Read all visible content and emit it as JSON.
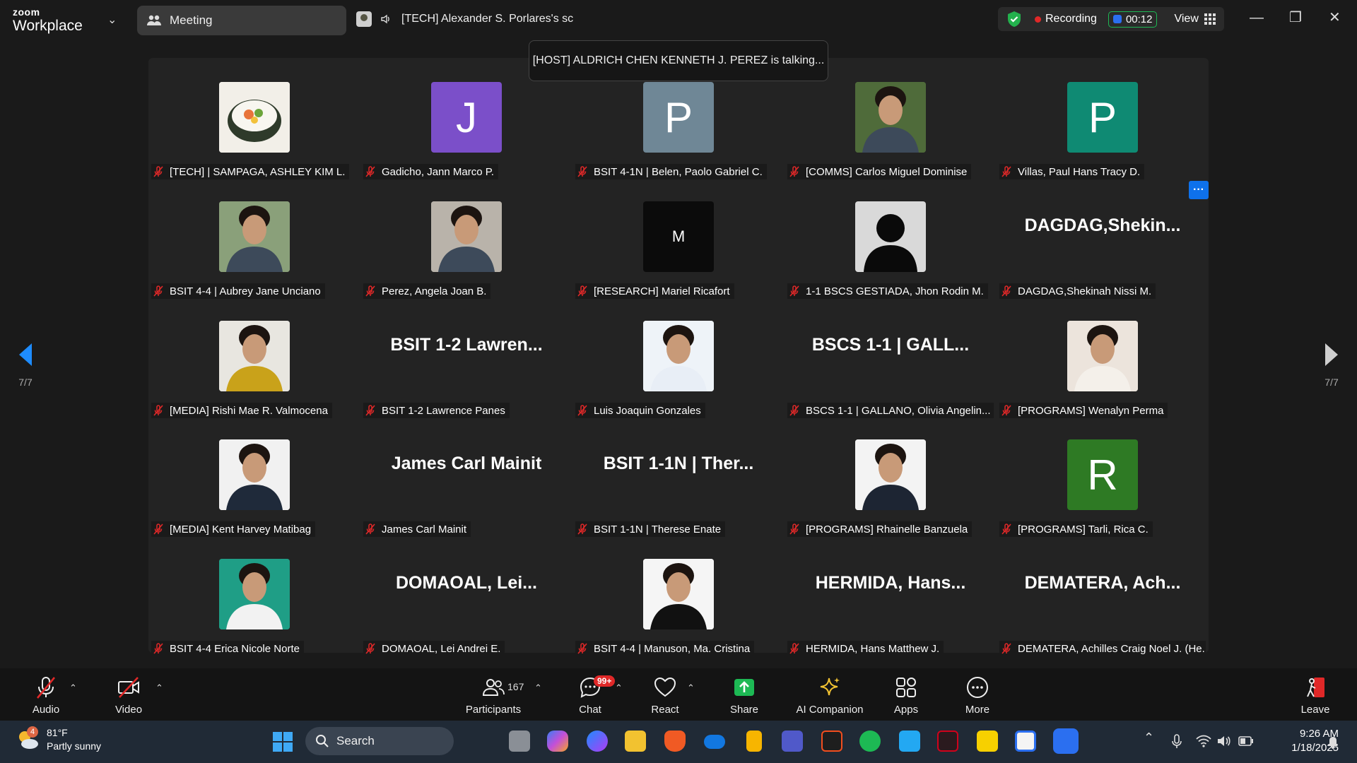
{
  "app": {
    "logo_top": "zoom",
    "logo_bottom": "Workplace"
  },
  "tab": {
    "label": "Meeting"
  },
  "speaker": {
    "label": "[TECH] Alexander S. Porlares's sc"
  },
  "status": {
    "recording": "Recording",
    "timer": "00:12",
    "view": "View"
  },
  "talking": "[HOST] ALDRICH CHEN KENNETH J. PEREZ is talking...",
  "participants": [
    {
      "name": "[TECH] | SAMPAGA, ASHLEY KIM L.",
      "kind": "photo",
      "bg": "#f2efe8",
      "glyph": "sushi"
    },
    {
      "name": "Gadicho, Jann Marco P.",
      "kind": "initial",
      "initial": "J",
      "bg": "#7b4fc9"
    },
    {
      "name": "BSIT 4-1N | Belen, Paolo Gabriel C.",
      "kind": "initial",
      "initial": "P",
      "bg": "#6f8796"
    },
    {
      "name": "[COMMS] Carlos Miguel Dominise",
      "kind": "photo",
      "bg": "#4f6b3a",
      "glyph": "person"
    },
    {
      "name": "Villas, Paul Hans Tracy D.",
      "kind": "initial",
      "initial": "P",
      "bg": "#0f8a73"
    },
    {
      "name": "BSIT 4-4 | Aubrey Jane Unciano",
      "kind": "photo",
      "bg": "#8aa07a",
      "glyph": "person"
    },
    {
      "name": "Perez, Angela Joan B.",
      "kind": "photo",
      "bg": "#b9b3aa",
      "glyph": "person"
    },
    {
      "name": "[RESEARCH] Mariel Ricafort",
      "kind": "initial",
      "initial": "M",
      "bg": "#0b0b0b",
      "small": true
    },
    {
      "name": "1-1 BSCS GESTIADA, Jhon Rodin M.",
      "kind": "silhouette",
      "bg": "#d9d9d9"
    },
    {
      "name": "DAGDAG,Shekinah Nissi M.",
      "kind": "text",
      "big": "DAGDAG,Shekin..."
    },
    {
      "name": "[MEDIA] Rishi Mae R. Valmocena",
      "kind": "photo",
      "bg": "#e8e6e0",
      "glyph": "person",
      "shirt": "#c9a21a"
    },
    {
      "name": "BSIT 1-2 Lawrence Panes",
      "kind": "text",
      "big": "BSIT 1-2 Lawren..."
    },
    {
      "name": "Luis Joaquin Gonzales",
      "kind": "photo",
      "bg": "#eef3f8",
      "glyph": "person",
      "shirt": "#e8eef6"
    },
    {
      "name": "BSCS 1-1 | GALLANO, Olivia Angelin...",
      "kind": "text",
      "big": "BSCS 1-1 | GALL..."
    },
    {
      "name": "[PROGRAMS] Wenalyn Perma",
      "kind": "photo",
      "bg": "#ece4dc",
      "glyph": "person",
      "shirt": "#f4f0ea"
    },
    {
      "name": "[MEDIA] Kent Harvey Matibag",
      "kind": "photo",
      "bg": "#f1f1f1",
      "glyph": "person",
      "shirt": "#1f2a3a"
    },
    {
      "name": "James Carl Mainit",
      "kind": "text",
      "big": "James Carl Mainit"
    },
    {
      "name": "BSIT 1-1N | Therese Enate",
      "kind": "text",
      "big": "BSIT 1-1N | Ther..."
    },
    {
      "name": "[PROGRAMS] Rhainelle Banzuela",
      "kind": "photo",
      "bg": "#f3f3f3",
      "glyph": "person",
      "shirt": "#1d2533"
    },
    {
      "name": "[PROGRAMS] Tarli, Rica C.",
      "kind": "initial",
      "initial": "R",
      "bg": "#2e7a24"
    },
    {
      "name": "BSIT 4-4 Erica Nicole Norte",
      "kind": "photo",
      "bg": "#1f9e86",
      "glyph": "person",
      "shirt": "#f2f2f2"
    },
    {
      "name": "DOMAOAL, Lei Andrei E.",
      "kind": "text",
      "big": "DOMAOAL, Lei..."
    },
    {
      "name": "BSIT 4-4 | Manuson, Ma. Cristina",
      "kind": "photo",
      "bg": "#f5f5f5",
      "glyph": "person",
      "shirt": "#111111"
    },
    {
      "name": "HERMIDA, Hans Matthew J.",
      "kind": "text",
      "big": "HERMIDA, Hans..."
    },
    {
      "name": "DEMATERA, Achilles Craig Noel J. (He...",
      "kind": "text",
      "big": "DEMATERA, Ach..."
    }
  ],
  "pager": {
    "left": "7/7",
    "right": "7/7"
  },
  "toolbar": {
    "audio": "Audio",
    "video": "Video",
    "participants": "Participants",
    "participant_count": "167",
    "chat": "Chat",
    "chat_badge": "99+",
    "react": "React",
    "share": "Share",
    "ai": "AI Companion",
    "apps": "Apps",
    "more": "More",
    "leave": "Leave"
  },
  "taskbar": {
    "temp": "81°F",
    "weather": "Partly sunny",
    "weather_badge": "4",
    "search": "Search",
    "time": "9:26 AM",
    "date": "1/18/2025"
  },
  "colors": {
    "accent": "#0e71eb",
    "recording": "#e02828",
    "share": "#1db954",
    "mute": "#e02828"
  }
}
